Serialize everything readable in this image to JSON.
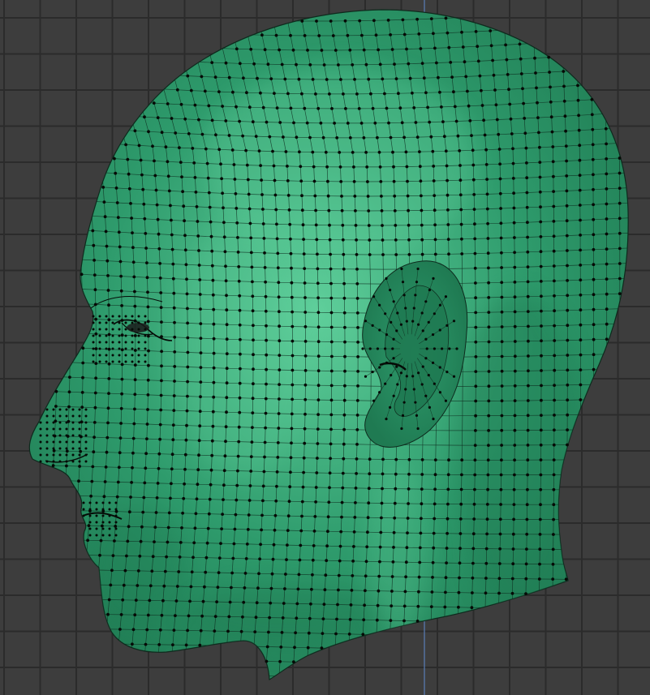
{
  "viewport": {
    "background_color": "#3d3d3d",
    "grid_color": "#2b2b2b",
    "axis_line_color": "#5a7fb8",
    "grid_visible": true
  },
  "model": {
    "mesh_color": "#2e9b6c",
    "mesh_highlight_color": "#5fcf9b",
    "mesh_shadow_color": "#1f7a52",
    "wire_color": "#0e2a1d",
    "vertex_color": "#050a06",
    "wireframe_visible": true,
    "vertices_visible": true,
    "view": "left side"
  }
}
